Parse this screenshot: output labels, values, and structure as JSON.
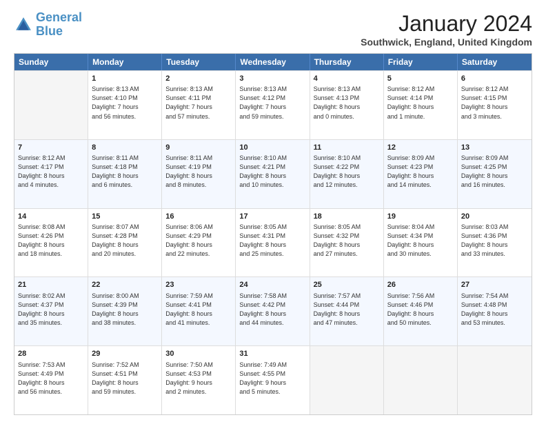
{
  "logo": {
    "line1": "General",
    "line2": "Blue"
  },
  "title": "January 2024",
  "location": "Southwick, England, United Kingdom",
  "weekdays": [
    "Sunday",
    "Monday",
    "Tuesday",
    "Wednesday",
    "Thursday",
    "Friday",
    "Saturday"
  ],
  "rows": [
    [
      {
        "day": "",
        "empty": true
      },
      {
        "day": "1",
        "sunrise": "Sunrise: 8:13 AM",
        "sunset": "Sunset: 4:10 PM",
        "daylight": "Daylight: 7 hours",
        "daylight2": "and 56 minutes."
      },
      {
        "day": "2",
        "sunrise": "Sunrise: 8:13 AM",
        "sunset": "Sunset: 4:11 PM",
        "daylight": "Daylight: 7 hours",
        "daylight2": "and 57 minutes."
      },
      {
        "day": "3",
        "sunrise": "Sunrise: 8:13 AM",
        "sunset": "Sunset: 4:12 PM",
        "daylight": "Daylight: 7 hours",
        "daylight2": "and 59 minutes."
      },
      {
        "day": "4",
        "sunrise": "Sunrise: 8:13 AM",
        "sunset": "Sunset: 4:13 PM",
        "daylight": "Daylight: 8 hours",
        "daylight2": "and 0 minutes."
      },
      {
        "day": "5",
        "sunrise": "Sunrise: 8:12 AM",
        "sunset": "Sunset: 4:14 PM",
        "daylight": "Daylight: 8 hours",
        "daylight2": "and 1 minute."
      },
      {
        "day": "6",
        "sunrise": "Sunrise: 8:12 AM",
        "sunset": "Sunset: 4:15 PM",
        "daylight": "Daylight: 8 hours",
        "daylight2": "and 3 minutes."
      }
    ],
    [
      {
        "day": "7",
        "sunrise": "Sunrise: 8:12 AM",
        "sunset": "Sunset: 4:17 PM",
        "daylight": "Daylight: 8 hours",
        "daylight2": "and 4 minutes."
      },
      {
        "day": "8",
        "sunrise": "Sunrise: 8:11 AM",
        "sunset": "Sunset: 4:18 PM",
        "daylight": "Daylight: 8 hours",
        "daylight2": "and 6 minutes."
      },
      {
        "day": "9",
        "sunrise": "Sunrise: 8:11 AM",
        "sunset": "Sunset: 4:19 PM",
        "daylight": "Daylight: 8 hours",
        "daylight2": "and 8 minutes."
      },
      {
        "day": "10",
        "sunrise": "Sunrise: 8:10 AM",
        "sunset": "Sunset: 4:21 PM",
        "daylight": "Daylight: 8 hours",
        "daylight2": "and 10 minutes."
      },
      {
        "day": "11",
        "sunrise": "Sunrise: 8:10 AM",
        "sunset": "Sunset: 4:22 PM",
        "daylight": "Daylight: 8 hours",
        "daylight2": "and 12 minutes."
      },
      {
        "day": "12",
        "sunrise": "Sunrise: 8:09 AM",
        "sunset": "Sunset: 4:23 PM",
        "daylight": "Daylight: 8 hours",
        "daylight2": "and 14 minutes."
      },
      {
        "day": "13",
        "sunrise": "Sunrise: 8:09 AM",
        "sunset": "Sunset: 4:25 PM",
        "daylight": "Daylight: 8 hours",
        "daylight2": "and 16 minutes."
      }
    ],
    [
      {
        "day": "14",
        "sunrise": "Sunrise: 8:08 AM",
        "sunset": "Sunset: 4:26 PM",
        "daylight": "Daylight: 8 hours",
        "daylight2": "and 18 minutes."
      },
      {
        "day": "15",
        "sunrise": "Sunrise: 8:07 AM",
        "sunset": "Sunset: 4:28 PM",
        "daylight": "Daylight: 8 hours",
        "daylight2": "and 20 minutes."
      },
      {
        "day": "16",
        "sunrise": "Sunrise: 8:06 AM",
        "sunset": "Sunset: 4:29 PM",
        "daylight": "Daylight: 8 hours",
        "daylight2": "and 22 minutes."
      },
      {
        "day": "17",
        "sunrise": "Sunrise: 8:05 AM",
        "sunset": "Sunset: 4:31 PM",
        "daylight": "Daylight: 8 hours",
        "daylight2": "and 25 minutes."
      },
      {
        "day": "18",
        "sunrise": "Sunrise: 8:05 AM",
        "sunset": "Sunset: 4:32 PM",
        "daylight": "Daylight: 8 hours",
        "daylight2": "and 27 minutes."
      },
      {
        "day": "19",
        "sunrise": "Sunrise: 8:04 AM",
        "sunset": "Sunset: 4:34 PM",
        "daylight": "Daylight: 8 hours",
        "daylight2": "and 30 minutes."
      },
      {
        "day": "20",
        "sunrise": "Sunrise: 8:03 AM",
        "sunset": "Sunset: 4:36 PM",
        "daylight": "Daylight: 8 hours",
        "daylight2": "and 33 minutes."
      }
    ],
    [
      {
        "day": "21",
        "sunrise": "Sunrise: 8:02 AM",
        "sunset": "Sunset: 4:37 PM",
        "daylight": "Daylight: 8 hours",
        "daylight2": "and 35 minutes."
      },
      {
        "day": "22",
        "sunrise": "Sunrise: 8:00 AM",
        "sunset": "Sunset: 4:39 PM",
        "daylight": "Daylight: 8 hours",
        "daylight2": "and 38 minutes."
      },
      {
        "day": "23",
        "sunrise": "Sunrise: 7:59 AM",
        "sunset": "Sunset: 4:41 PM",
        "daylight": "Daylight: 8 hours",
        "daylight2": "and 41 minutes."
      },
      {
        "day": "24",
        "sunrise": "Sunrise: 7:58 AM",
        "sunset": "Sunset: 4:42 PM",
        "daylight": "Daylight: 8 hours",
        "daylight2": "and 44 minutes."
      },
      {
        "day": "25",
        "sunrise": "Sunrise: 7:57 AM",
        "sunset": "Sunset: 4:44 PM",
        "daylight": "Daylight: 8 hours",
        "daylight2": "and 47 minutes."
      },
      {
        "day": "26",
        "sunrise": "Sunrise: 7:56 AM",
        "sunset": "Sunset: 4:46 PM",
        "daylight": "Daylight: 8 hours",
        "daylight2": "and 50 minutes."
      },
      {
        "day": "27",
        "sunrise": "Sunrise: 7:54 AM",
        "sunset": "Sunset: 4:48 PM",
        "daylight": "Daylight: 8 hours",
        "daylight2": "and 53 minutes."
      }
    ],
    [
      {
        "day": "28",
        "sunrise": "Sunrise: 7:53 AM",
        "sunset": "Sunset: 4:49 PM",
        "daylight": "Daylight: 8 hours",
        "daylight2": "and 56 minutes."
      },
      {
        "day": "29",
        "sunrise": "Sunrise: 7:52 AM",
        "sunset": "Sunset: 4:51 PM",
        "daylight": "Daylight: 8 hours",
        "daylight2": "and 59 minutes."
      },
      {
        "day": "30",
        "sunrise": "Sunrise: 7:50 AM",
        "sunset": "Sunset: 4:53 PM",
        "daylight": "Daylight: 9 hours",
        "daylight2": "and 2 minutes."
      },
      {
        "day": "31",
        "sunrise": "Sunrise: 7:49 AM",
        "sunset": "Sunset: 4:55 PM",
        "daylight": "Daylight: 9 hours",
        "daylight2": "and 5 minutes."
      },
      {
        "day": "",
        "empty": true
      },
      {
        "day": "",
        "empty": true
      },
      {
        "day": "",
        "empty": true
      }
    ]
  ]
}
